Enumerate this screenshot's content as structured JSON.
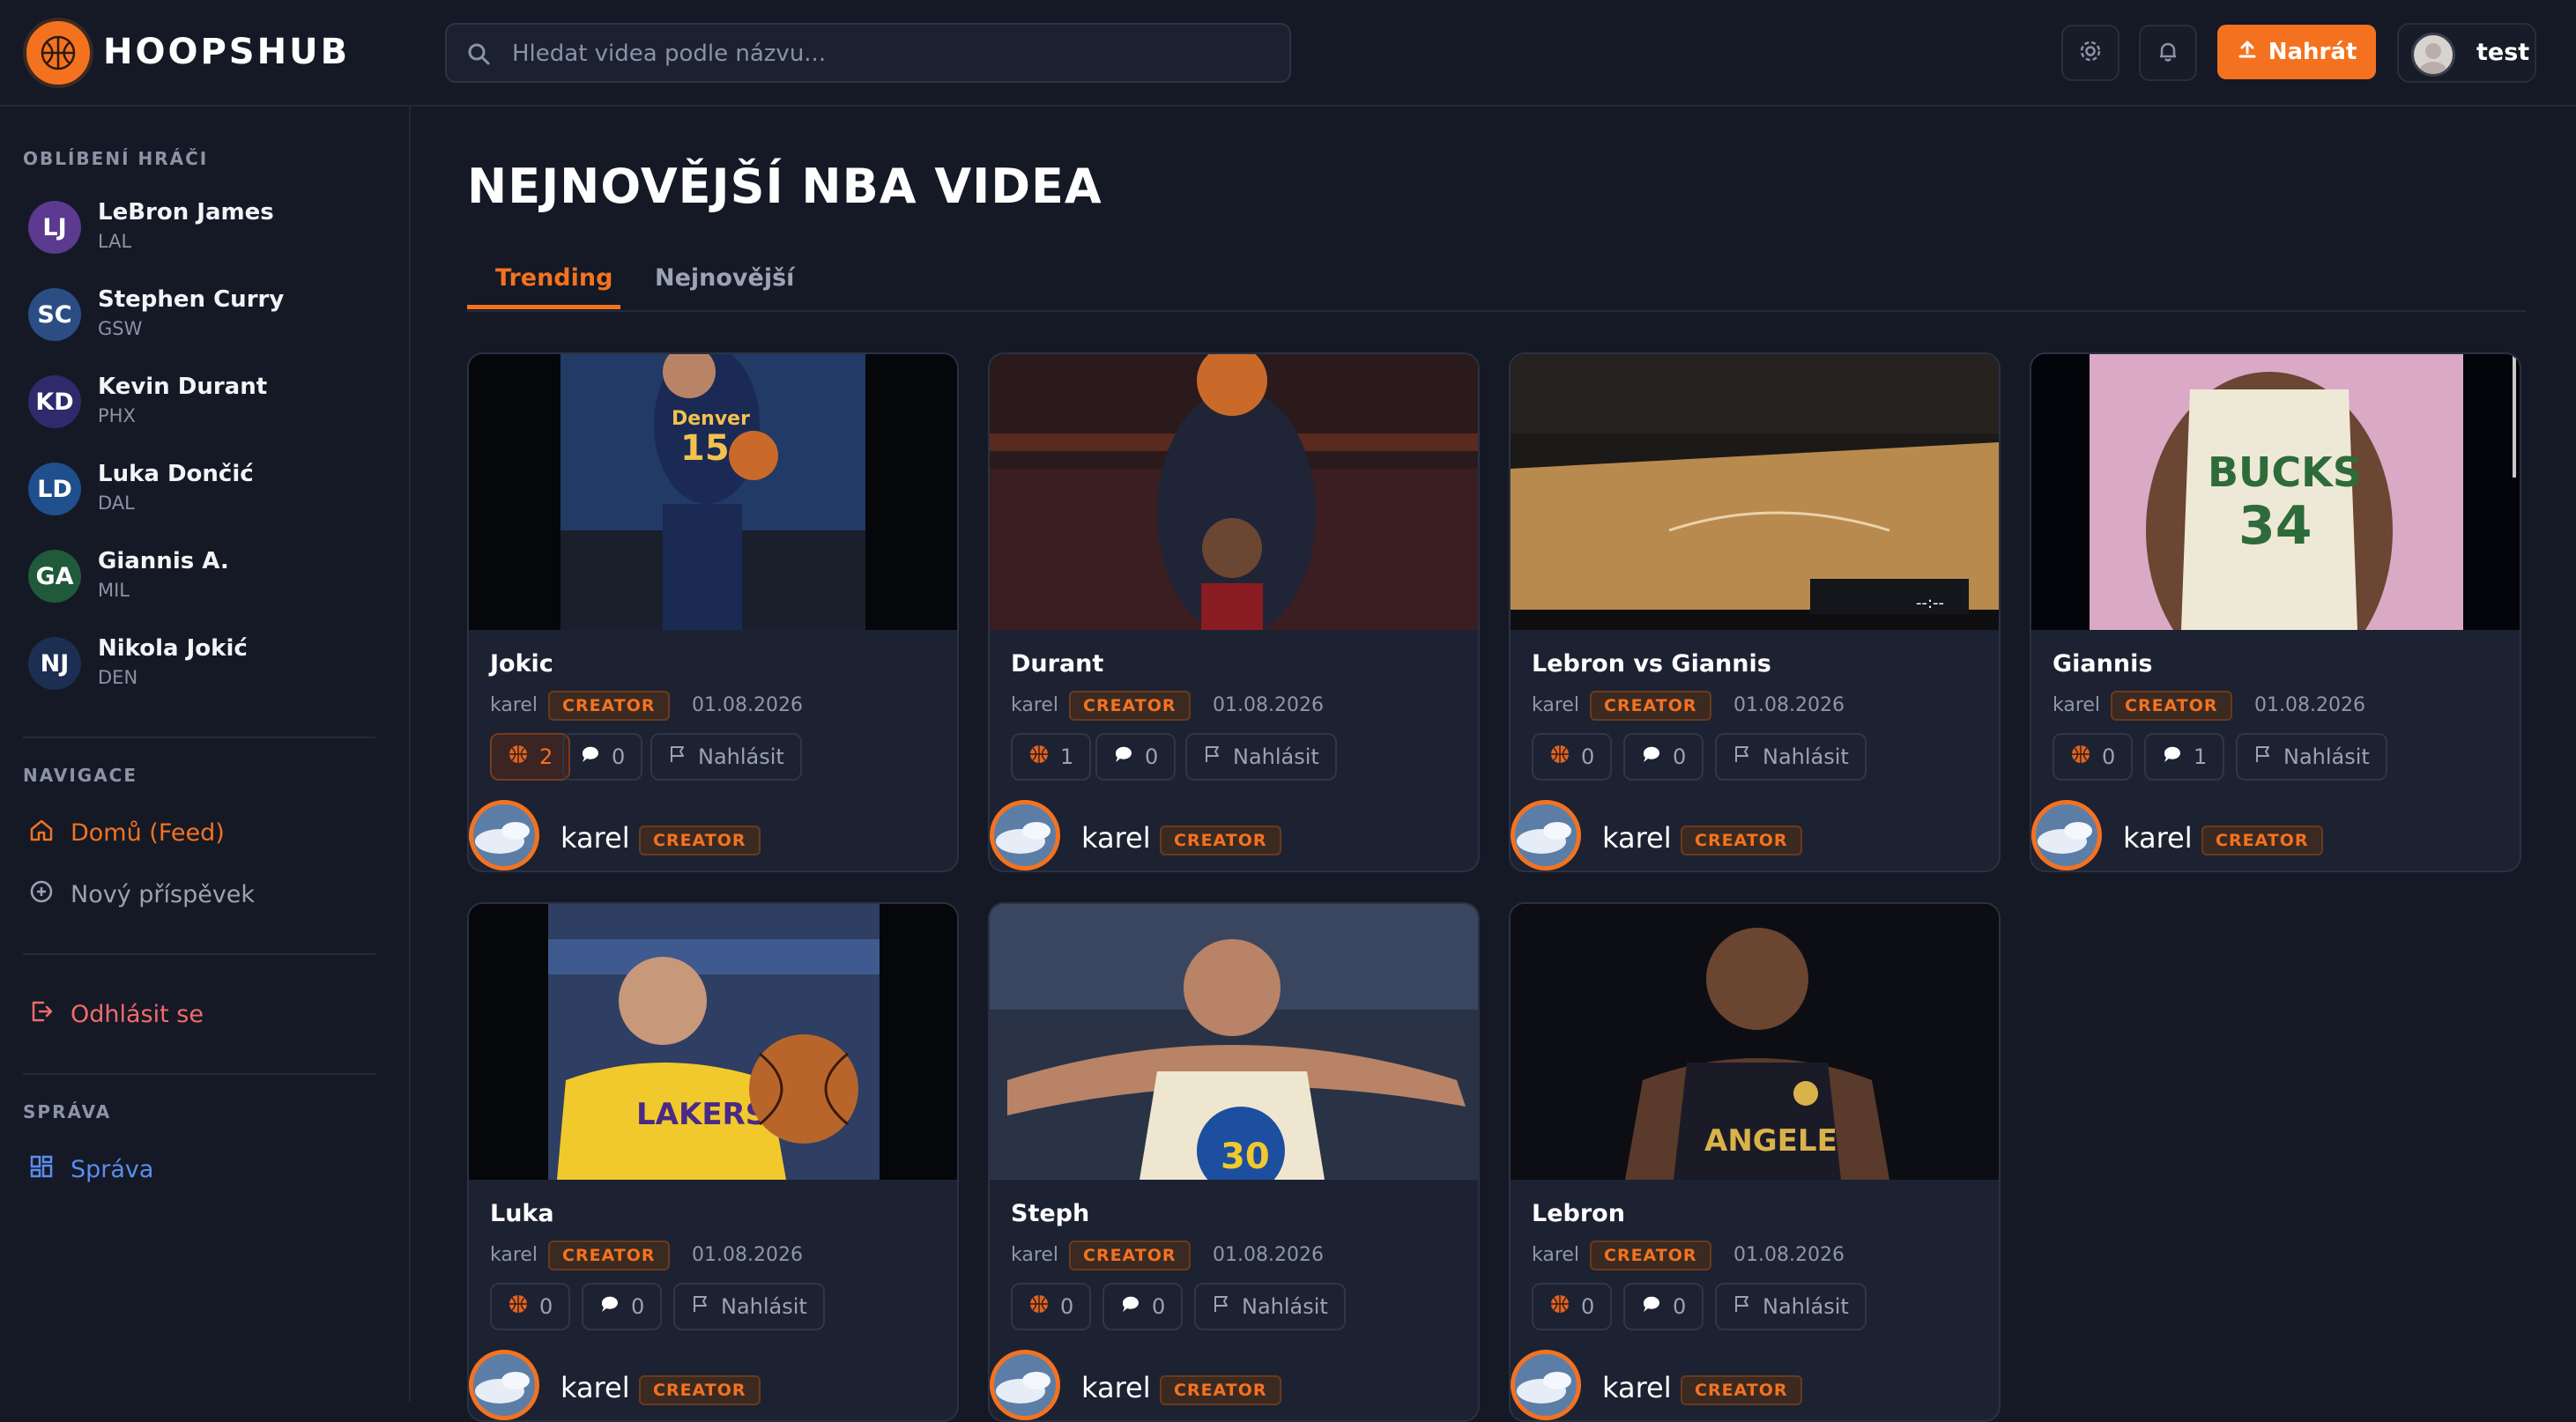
{
  "header": {
    "logo_text": "HOOPSHUB",
    "search_placeholder": "Hledat videa podle názvu...",
    "upload_label": "Nahrát",
    "user_name": "test"
  },
  "sidebar": {
    "favorites_title": "OBLÍBENÍ HRÁČI",
    "players": [
      {
        "initials": "LJ",
        "name": "LeBron James",
        "team": "LAL",
        "color": "#5b3a8f"
      },
      {
        "initials": "SC",
        "name": "Stephen Curry",
        "team": "GSW",
        "color": "#2c4d84"
      },
      {
        "initials": "KD",
        "name": "Kevin Durant",
        "team": "PHX",
        "color": "#2e2a6b"
      },
      {
        "initials": "LD",
        "name": "Luka Dončić",
        "team": "DAL",
        "color": "#1f4f8c"
      },
      {
        "initials": "GA",
        "name": "Giannis A.",
        "team": "MIL",
        "color": "#1f5a3a"
      },
      {
        "initials": "NJ",
        "name": "Nikola Jokić",
        "team": "DEN",
        "color": "#1c2e52"
      }
    ],
    "nav_title": "NAVIGACE",
    "nav_home": "Domů (Feed)",
    "nav_new_post": "Nový příspěvek",
    "logout": "Odhlásit se",
    "admin_title": "SPRÁVA",
    "admin_link": "Správa"
  },
  "main": {
    "title": "NEJNOVĚJŠÍ NBA VIDEA",
    "tabs": [
      "Trending",
      "Nejnovější"
    ],
    "report_label": "Nahlásit",
    "badge_label": "CREATOR",
    "videos": [
      {
        "title": "Jokic",
        "author": "karel",
        "date": "01.08.2026",
        "likes": "2",
        "comments": "0",
        "liked": true
      },
      {
        "title": "Durant",
        "author": "karel",
        "date": "01.08.2026",
        "likes": "1",
        "comments": "0",
        "liked": false
      },
      {
        "title": "Lebron vs Giannis",
        "author": "karel",
        "date": "01.08.2026",
        "likes": "0",
        "comments": "0",
        "liked": false,
        "video_time": "--:--"
      },
      {
        "title": "Giannis",
        "author": "karel",
        "date": "01.08.2026",
        "likes": "0",
        "comments": "1",
        "liked": false
      },
      {
        "title": "Luka",
        "author": "karel",
        "date": "01.08.2026",
        "likes": "0",
        "comments": "0",
        "liked": false
      },
      {
        "title": "Steph",
        "author": "karel",
        "date": "01.08.2026",
        "likes": "0",
        "comments": "0",
        "liked": false
      },
      {
        "title": "Lebron",
        "author": "karel",
        "date": "01.08.2026",
        "likes": "0",
        "comments": "0",
        "liked": false
      }
    ]
  },
  "colors": {
    "accent": "#f4721f",
    "admin": "#5b8def",
    "logout": "#f26b6b",
    "background": "#141925",
    "card": "#1d2232"
  }
}
